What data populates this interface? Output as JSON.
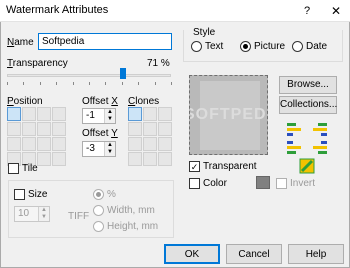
{
  "window": {
    "title": "Watermark Attributes",
    "help_glyph": "?",
    "close_glyph": "✕"
  },
  "name": {
    "label": "Name",
    "value": "Softpedia"
  },
  "transparency": {
    "label": "Transparency",
    "value_text": "71 %",
    "value": 71
  },
  "position": {
    "label": "Position"
  },
  "offset_x": {
    "label": "Offset X",
    "value": "-1"
  },
  "offset_y": {
    "label": "Offset Y",
    "value": "-3"
  },
  "clones": {
    "label": "Clones"
  },
  "tile": {
    "label": "Tile"
  },
  "size_group": {
    "size_label": "Size",
    "size_value": "10",
    "tiff_label": "TIFF",
    "percent_label": "%",
    "width_label": "Width, mm",
    "height_label": "Height, mm"
  },
  "style": {
    "label": "Style",
    "options": [
      "Text",
      "Picture",
      "Date"
    ],
    "selected": "Picture"
  },
  "preview": {
    "watermark_text": "SOFTPEDIA"
  },
  "buttons": {
    "browse": "Browse...",
    "collections": "Collections...",
    "ok": "OK",
    "cancel": "Cancel",
    "help": "Help"
  },
  "transparent": {
    "label": "Transparent",
    "checked": true
  },
  "color": {
    "label": "Color",
    "swatch": "#808080"
  },
  "invert": {
    "label": "Invert"
  },
  "colors": {
    "accent": "#0078d7",
    "icon_green": "#2e9e3a",
    "icon_yellow": "#f2c200",
    "icon_blue": "#2a4fbf"
  }
}
